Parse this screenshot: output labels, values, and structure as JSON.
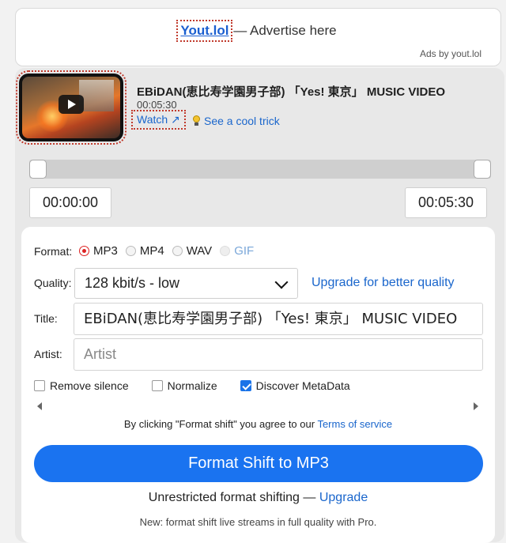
{
  "ad": {
    "link_text": "Yout.lol",
    "text": " — Advertise here",
    "by": "Ads by yout.lol"
  },
  "video": {
    "title": "EBiDAN(恵比寿学園男子部) 「Yes! 東京」 MUSIC VIDEO",
    "duration": "00:05:30",
    "watch_label": "Watch ↗",
    "trick_label": "See a cool trick"
  },
  "range": {
    "start_time": "00:00:00",
    "end_time": "00:05:30",
    "start_fraction": 0.0,
    "end_fraction": 1.0
  },
  "form": {
    "format_label": "Format:",
    "formats": [
      {
        "label": "MP3",
        "selected": true,
        "disabled": false
      },
      {
        "label": "MP4",
        "selected": false,
        "disabled": false
      },
      {
        "label": "WAV",
        "selected": false,
        "disabled": false
      },
      {
        "label": "GIF",
        "selected": false,
        "disabled": true
      }
    ],
    "quality_label": "Quality:",
    "quality_value": "128 kbit/s - low",
    "upgrade_quality": "Upgrade for better quality",
    "title_label": "Title:",
    "title_value": "EBiDAN(恵比寿学園男子部) 「Yes! 東京」 MUSIC VIDEO",
    "artist_label": "Artist:",
    "artist_placeholder": "Artist",
    "options": [
      {
        "label": "Remove silence",
        "checked": false
      },
      {
        "label": "Normalize",
        "checked": false
      },
      {
        "label": "Discover MetaData",
        "checked": true
      }
    ],
    "terms_prefix": "By clicking \"Format shift\" you agree to our ",
    "terms_link": "Terms of service",
    "cta_label": "Format Shift to MP3",
    "unrestricted_text": "Unrestricted format shifting — ",
    "unrestricted_link": "Upgrade",
    "pro_note": "New: format shift live streams in full quality with Pro."
  },
  "colors": {
    "accent": "#1a73f0",
    "link": "#1a66cc",
    "radio_selected": "#dd2222"
  },
  "icons": {
    "play": "play-icon",
    "bulb": "lightbulb-icon",
    "chevron": "chevron-down-icon"
  }
}
